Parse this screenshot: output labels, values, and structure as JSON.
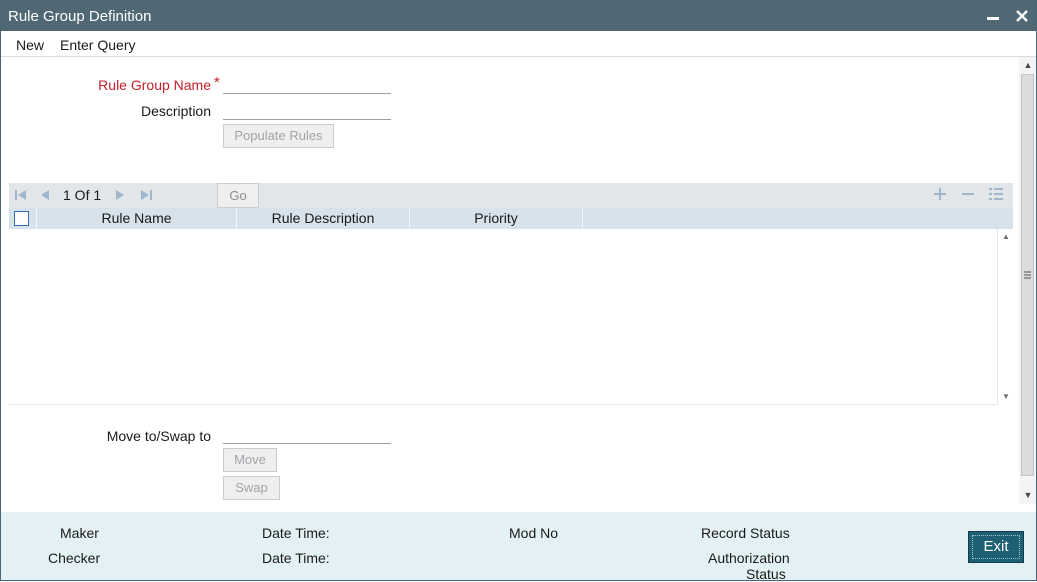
{
  "window": {
    "title": "Rule Group Definition",
    "minimize_icon": "minus-icon",
    "close_icon": "close-icon"
  },
  "menu": {
    "new_label": "New",
    "enter_query_label": "Enter Query"
  },
  "form": {
    "rule_group_name_label": "Rule Group Name",
    "required_marker": "*",
    "rule_group_name_value": "",
    "description_label": "Description",
    "description_value": "",
    "populate_rules_label": "Populate Rules"
  },
  "grid": {
    "page_text": "1 Of 1",
    "go_label": "Go",
    "columns": [
      "Rule Name",
      "Rule Description",
      "Priority"
    ],
    "rows": [],
    "icons": {
      "first": "first-page-icon",
      "prev": "prev-page-icon",
      "next": "next-page-icon",
      "last": "last-page-icon",
      "add": "add-row-icon",
      "delete": "delete-row-icon",
      "single_view": "single-view-icon"
    }
  },
  "move": {
    "label": "Move to/Swap to",
    "value": "",
    "move_label": "Move",
    "swap_label": "Swap"
  },
  "footer": {
    "maker_label": "Maker",
    "checker_label": "Checker",
    "date_time_label_1": "Date Time:",
    "date_time_label_2": "Date Time:",
    "mod_no_label": "Mod No",
    "record_status_label": "Record Status",
    "authorization_status_label_1": "Authorization",
    "authorization_status_label_2": "Status",
    "exit_label": "Exit"
  },
  "colors": {
    "titlebar": "#4f6874",
    "required": "#c8202a",
    "grid_header": "#d7e2ea",
    "footer": "#e3f1f5",
    "exit_button": "#1e5f73"
  }
}
